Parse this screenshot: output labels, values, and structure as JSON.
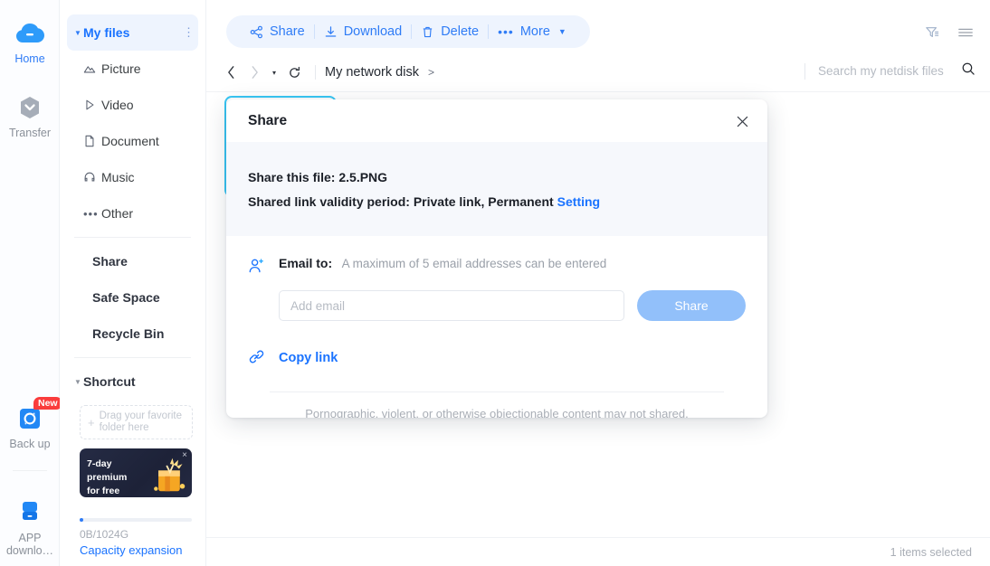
{
  "rail": {
    "items": [
      {
        "id": "home",
        "label": "Home",
        "icon": "cloud-icon",
        "active": true,
        "badge": ""
      },
      {
        "id": "transfer",
        "label": "Transfer",
        "icon": "transfer-icon",
        "active": false,
        "badge": ""
      },
      {
        "id": "backup",
        "label": "Back up",
        "icon": "backup-icon",
        "active": false,
        "badge": "New"
      },
      {
        "id": "app",
        "label": "APP downlo…",
        "icon": "device-icon",
        "active": false,
        "badge": ""
      }
    ]
  },
  "sidebar": {
    "items": [
      {
        "label": "My files",
        "icon": "caret-down-icon",
        "selected": true,
        "menu": "more-dots-icon"
      },
      {
        "label": "Picture",
        "icon": "picture-icon",
        "selected": false
      },
      {
        "label": "Video",
        "icon": "video-icon",
        "selected": false
      },
      {
        "label": "Document",
        "icon": "document-icon",
        "selected": false
      },
      {
        "label": "Music",
        "icon": "music-icon",
        "selected": false
      },
      {
        "label": "Other",
        "icon": "other-dots-icon",
        "selected": false
      }
    ],
    "links": [
      {
        "label": "Share"
      },
      {
        "label": "Safe Space"
      },
      {
        "label": "Recycle Bin"
      }
    ],
    "shortcut": {
      "label": "Shortcut",
      "dropzone_text": "Drag your favorite folder here"
    },
    "promo": {
      "line1": "7-day premium",
      "line2": "for free",
      "close": "×"
    },
    "capacity": {
      "used_total": "0B/1024G",
      "expand_label": "Capacity expansion",
      "percent": 1
    }
  },
  "toolbar": {
    "buttons": [
      {
        "label": "Share",
        "icon": "share-node-icon"
      },
      {
        "label": "Download",
        "icon": "download-icon"
      },
      {
        "label": "Delete",
        "icon": "trash-icon"
      },
      {
        "label": "More",
        "icon": "ellipsis-icon",
        "caret": "▼"
      }
    ],
    "right_icons": [
      {
        "name": "filter-icon"
      },
      {
        "name": "list-view-icon"
      }
    ]
  },
  "breadcrumb": {
    "back": "‹",
    "forward": "›",
    "history_caret": "▾",
    "refresh": "refresh-icon",
    "path": "My network disk",
    "separator": ">"
  },
  "search": {
    "placeholder": "Search my netdisk files",
    "value": "",
    "icon": "search-icon"
  },
  "statusbar": {
    "selection": "1 items selected"
  },
  "modal": {
    "title": "Share",
    "close": "✕",
    "file_line": "Share this file: 2.5.PNG",
    "validity_line": "Shared link validity period: Private link, Permanent",
    "setting_link": "Setting",
    "email_label": "Email to:",
    "email_hint": "A maximum of 5 email addresses can be entered",
    "email_placeholder": "Add email",
    "email_value": "",
    "share_button": "Share",
    "copy_link": "Copy link",
    "copy_icon": "chain-link-icon",
    "person_icon": "person-add-icon",
    "footer_note": "Pornographic, violent, or otherwise objectionable content may not shared."
  },
  "colors": {
    "accent": "#1a73ff",
    "toolbar_text": "#2f7cf6",
    "toolbar_pill": "#eef4fe",
    "share_button": "#92c0fa",
    "badge_red": "#fa3c3c",
    "selection_border": "#38c6f4"
  }
}
